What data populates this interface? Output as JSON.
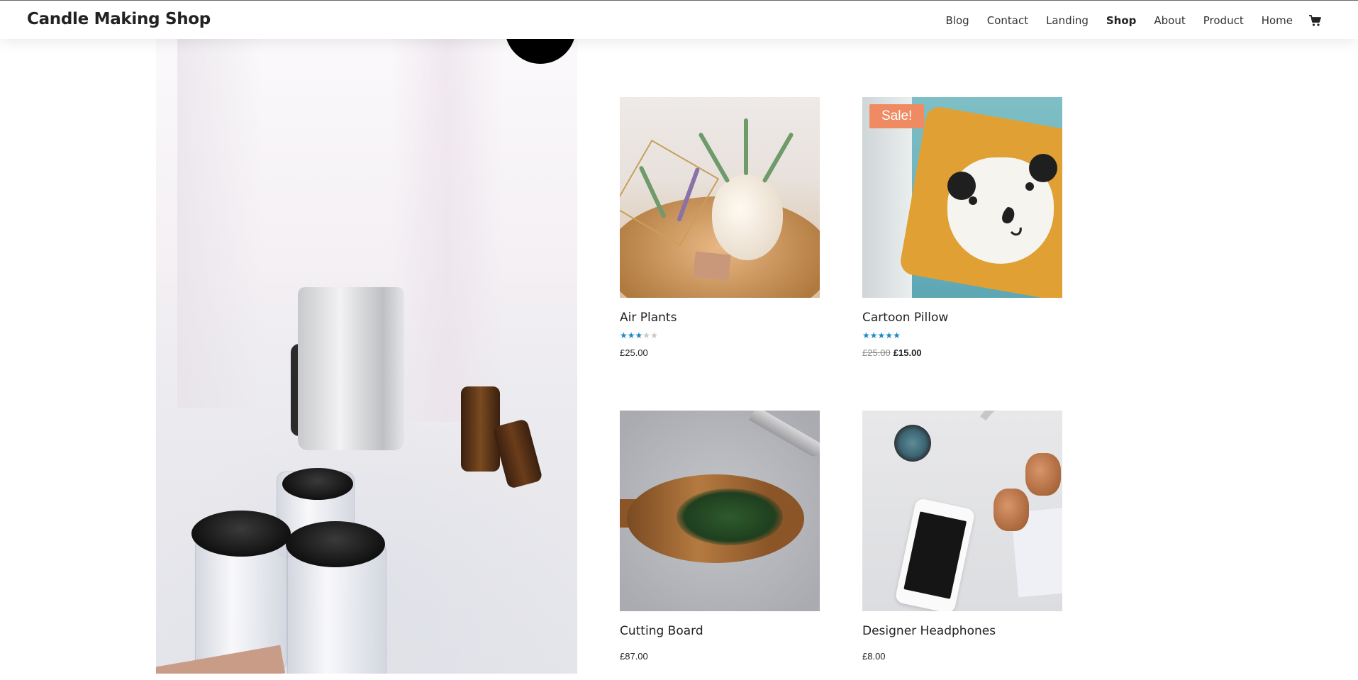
{
  "header": {
    "logo": "Candle Making Shop",
    "nav": [
      {
        "label": "Blog",
        "active": false
      },
      {
        "label": "Contact",
        "active": false
      },
      {
        "label": "Landing",
        "active": false
      },
      {
        "label": "Shop",
        "active": true
      },
      {
        "label": "About",
        "active": false
      },
      {
        "label": "Product",
        "active": false
      },
      {
        "label": "Home",
        "active": false
      }
    ],
    "cart_icon": "shopping-cart-icon"
  },
  "products": [
    {
      "name": "Air Plants",
      "rating": 3,
      "rating_max": 5,
      "price": "£25.00",
      "old_price": null,
      "sale": null
    },
    {
      "name": "Cartoon Pillow",
      "rating": 5,
      "rating_max": 5,
      "price": "£15.00",
      "old_price": "£25.00",
      "sale": "Sale!"
    },
    {
      "name": "Cutting Board",
      "rating": null,
      "rating_max": 5,
      "price": "£87.00",
      "old_price": null,
      "sale": null
    },
    {
      "name": "Designer Headphones",
      "rating": null,
      "rating_max": 5,
      "price": "£8.00",
      "old_price": null,
      "sale": null
    }
  ],
  "colors": {
    "star": "#1e88c8",
    "sale_badge": "#ef8a62"
  }
}
